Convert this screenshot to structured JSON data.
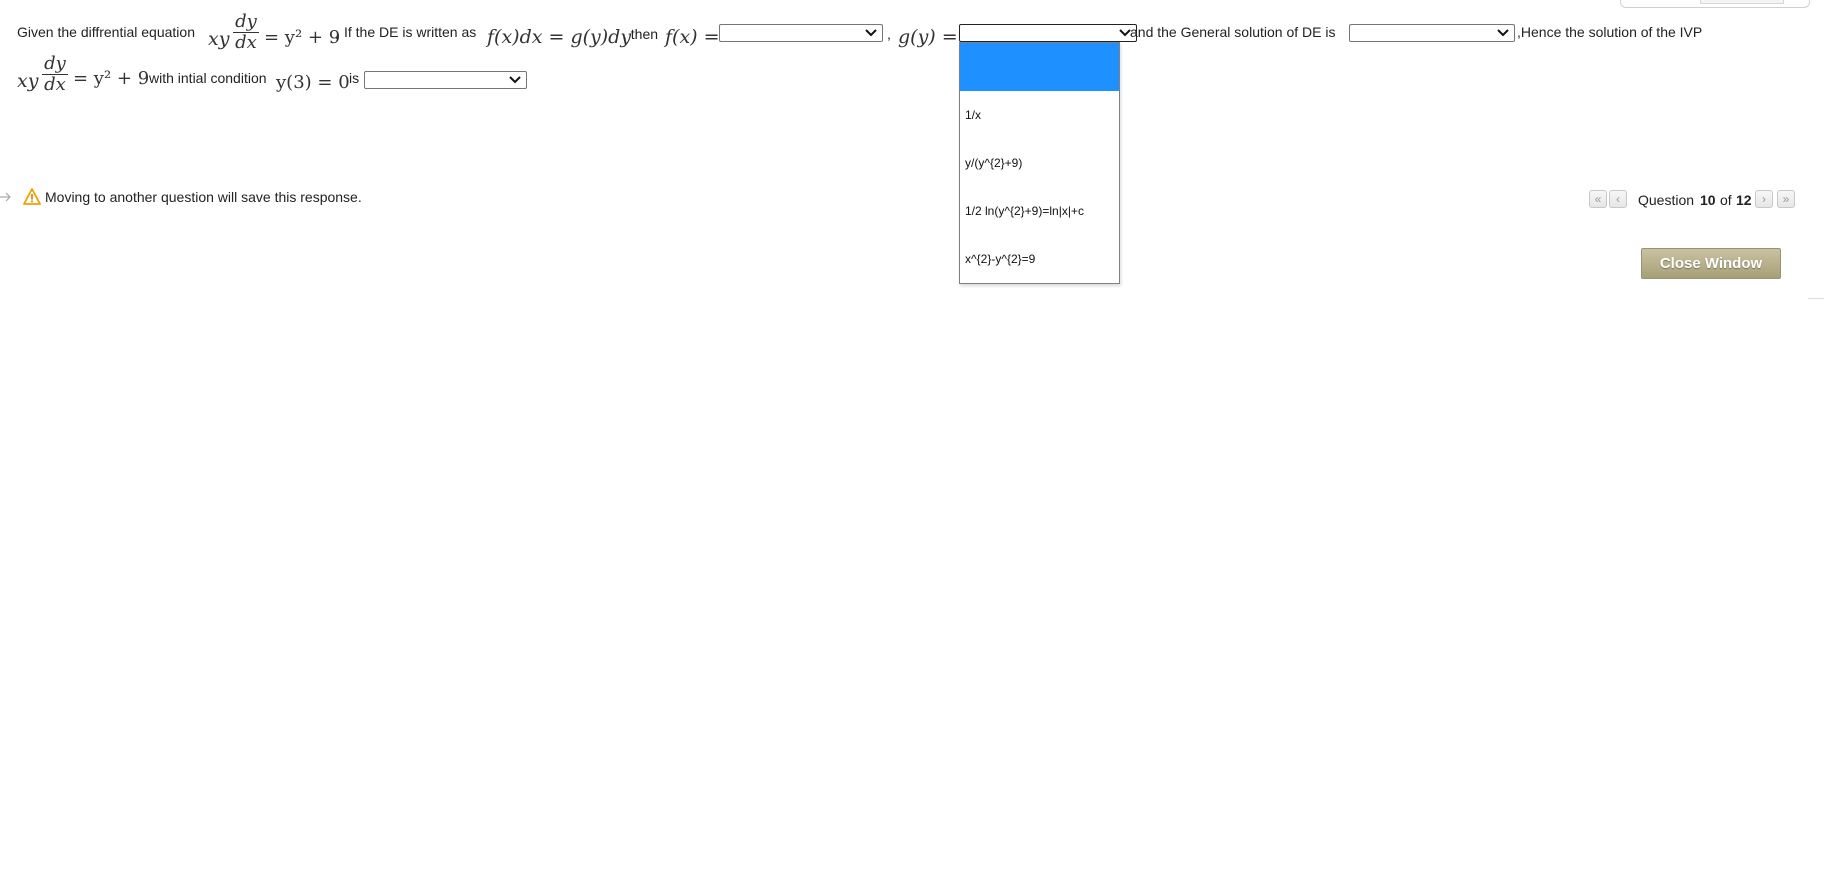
{
  "question": {
    "intro": "Given the diffrential equation",
    "eq_lhs_var": "xy",
    "eq_num": "dy",
    "eq_den": "dx",
    "eq_rhs": "= y² + 9",
    "sep1": ",",
    "if_text": "If the DE is written as",
    "form": "f(x)dx = g(y)dy",
    "then_text": ", then",
    "fx_label": "f(x) =",
    "comma2": ",",
    "gy_label": "g(y) =",
    "general_text": "and the General solution of DE is",
    "hence_text": ",Hence the solution of the IVP",
    "line2_rhs": "= y² + 9",
    "initial_text": "with intial condition",
    "initial_cond": "y(3) = 0",
    "is_text": "is"
  },
  "dropdown": {
    "options": [
      "",
      "1/x",
      "y/(y^{2}+9)",
      "1/2 ln(y^{2}+9)=ln|x|+c",
      "x^{2}-y^{2}=9"
    ]
  },
  "footer": {
    "warning": "Moving to another question will save this response.",
    "question_word": "Question",
    "current": "10",
    "of_word": "of",
    "total": "12",
    "close_label": "Close Window"
  },
  "colors": {
    "highlight": "#1e90ff",
    "warning": "#f0a000",
    "close_button": "#b5ad87"
  }
}
